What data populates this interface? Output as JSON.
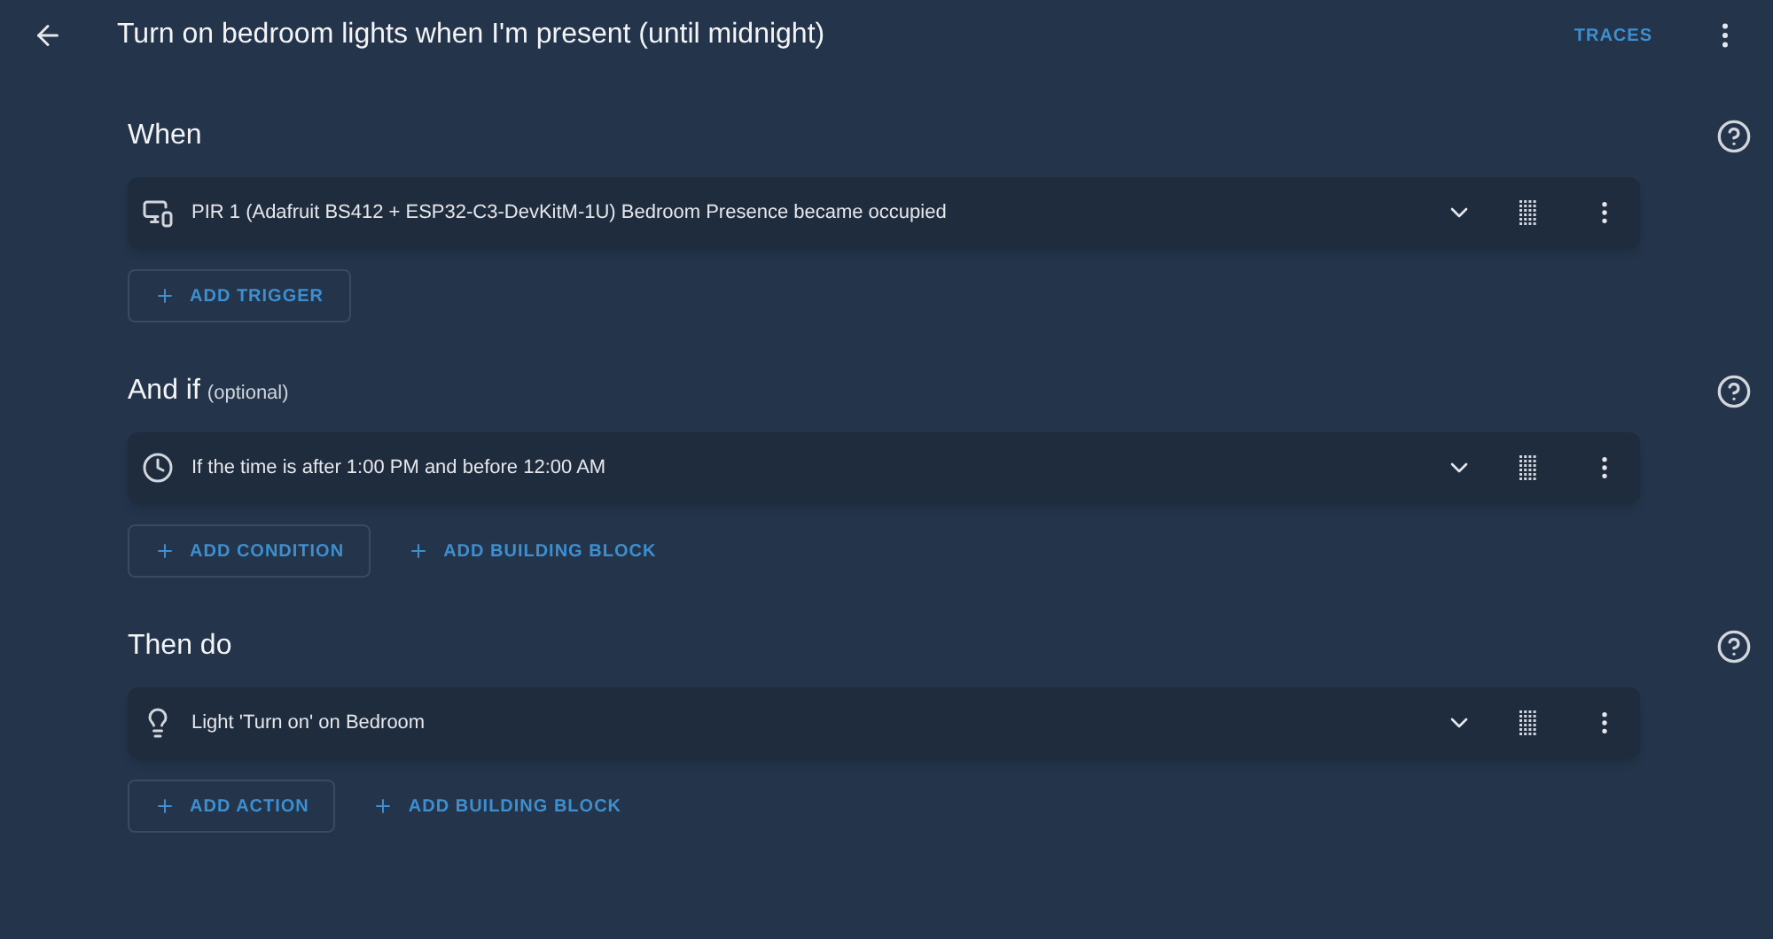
{
  "header": {
    "title": "Turn on bedroom lights when I'm present (until midnight)",
    "traces_button": "TRACES"
  },
  "sections": [
    {
      "title": "When",
      "items": [
        {
          "kind": "device",
          "text": "PIR 1 (Adafruit BS412 + ESP32-C3-DevKitM-1U) Bedroom Presence became occupied"
        }
      ],
      "buttons": [
        {
          "kind": "outlined",
          "label": "ADD TRIGGER"
        }
      ]
    },
    {
      "title": "And if",
      "subtitle": "(optional)",
      "items": [
        {
          "kind": "time",
          "text": "If the time is after 1:00 PM and before 12:00 AM"
        }
      ],
      "buttons": [
        {
          "kind": "outlined",
          "label": "ADD CONDITION"
        },
        {
          "kind": "text",
          "label": "ADD BUILDING BLOCK"
        }
      ]
    },
    {
      "title": "Then do",
      "items": [
        {
          "kind": "light",
          "text": "Light 'Turn on' on Bedroom"
        }
      ],
      "buttons": [
        {
          "kind": "outlined",
          "label": "ADD ACTION"
        },
        {
          "kind": "text",
          "label": "ADD BUILDING BLOCK"
        }
      ]
    }
  ]
}
